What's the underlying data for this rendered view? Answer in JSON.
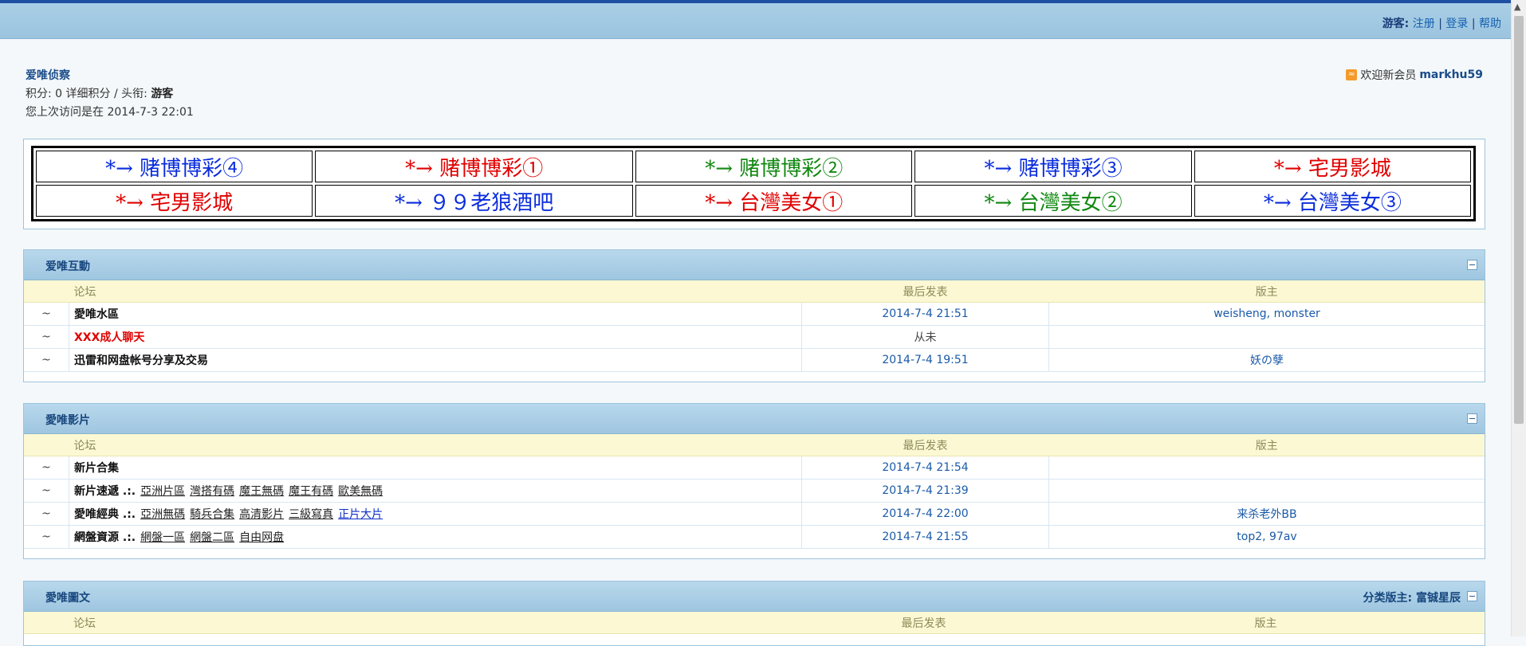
{
  "usernav": {
    "guest_label": "游客:",
    "register": "注册",
    "sep1": "|",
    "login": "登录",
    "sep2": "|",
    "help": "帮助"
  },
  "info": {
    "forum_name": "爱唯侦察",
    "points_line": "积分: 0 详细积分 / 头衔: ",
    "title_value": "游客",
    "last_visit": "您上次访问是在 2014-7-3 22:01"
  },
  "welcome": {
    "text": "欢迎新会员",
    "member": "markhu59",
    "icon": "rss-icon"
  },
  "ads": [
    [
      {
        "text": "*→ 赌博博彩④",
        "color": "blue"
      },
      {
        "text": "*→ 赌博博彩①",
        "color": "red"
      },
      {
        "text": "*→ 赌博博彩②",
        "color": "green"
      },
      {
        "text": "*→ 赌博博彩③",
        "color": "blue"
      },
      {
        "text": "*→ 宅男影城",
        "color": "red"
      }
    ],
    [
      {
        "text": "*→ 宅男影城",
        "color": "red"
      },
      {
        "text": "*→ ９９老狼酒吧",
        "color": "blue"
      },
      {
        "text": "*→ 台灣美女①",
        "color": "red"
      },
      {
        "text": "*→ 台灣美女②",
        "color": "green"
      },
      {
        "text": "*→ 台灣美女③",
        "color": "blue"
      }
    ]
  ],
  "columns": {
    "forum": "论坛",
    "last_post": "最后发表",
    "moderator": "版主"
  },
  "sections": [
    {
      "title": "爱唯互動",
      "mod_label": "",
      "rows": [
        {
          "icon": "~",
          "name": "愛唯水區",
          "hot": false,
          "subs": [],
          "last": "2014-7-4 21:51",
          "mods": "weisheng, monster"
        },
        {
          "icon": "~",
          "name": "XXX成人聊天",
          "hot": true,
          "subs": [],
          "last": "从未",
          "mods": ""
        },
        {
          "icon": "~",
          "name": "迅雷和网盘帐号分享及交易",
          "hot": false,
          "subs": [],
          "last": "2014-7-4 19:51",
          "mods": "妖の孽"
        }
      ]
    },
    {
      "title": "愛唯影片",
      "mod_label": "",
      "rows": [
        {
          "icon": "~",
          "name": "新片合集",
          "hot": false,
          "subs": [],
          "last": "2014-7-4 21:54",
          "mods": ""
        },
        {
          "icon": "~",
          "name": "新片速遞 .:.",
          "hot": false,
          "subs": [
            {
              "t": "亞洲片區",
              "link": false
            },
            {
              "t": "灣搭有碼",
              "link": false
            },
            {
              "t": "魔王無碼",
              "link": false
            },
            {
              "t": "魔王有碼",
              "link": false
            },
            {
              "t": "歐美無碼",
              "link": false
            }
          ],
          "last": "2014-7-4 21:39",
          "mods": ""
        },
        {
          "icon": "~",
          "name": "愛唯經典 .:.",
          "hot": false,
          "subs": [
            {
              "t": "亞洲無碼",
              "link": false
            },
            {
              "t": "騎兵合集",
              "link": false
            },
            {
              "t": "高清影片",
              "link": false
            },
            {
              "t": "三級寫真",
              "link": false
            },
            {
              "t": "正片大片",
              "link": true
            }
          ],
          "last": "2014-7-4 22:00",
          "mods": "来杀老外BB"
        },
        {
          "icon": "~",
          "name": "網盤資源 .:.",
          "hot": false,
          "subs": [
            {
              "t": "網盤一區",
              "link": false
            },
            {
              "t": "網盤二區",
              "link": false
            },
            {
              "t": "自由网盘",
              "link": false
            }
          ],
          "last": "2014-7-4 21:55",
          "mods": "top2, 97av"
        }
      ]
    },
    {
      "title": "愛唯圖文",
      "mod_label": "分类版主: 富铖星辰",
      "rows": []
    }
  ]
}
